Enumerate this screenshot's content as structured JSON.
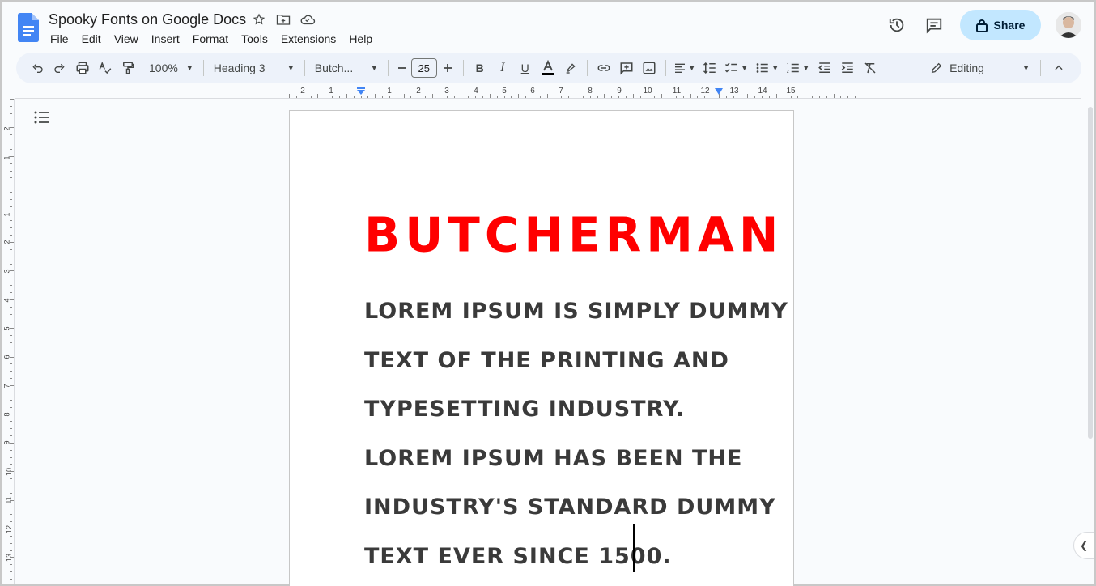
{
  "doc": {
    "title": "Spooky Fonts on Google Docs",
    "menu": [
      "File",
      "Edit",
      "View",
      "Insert",
      "Format",
      "Tools",
      "Extensions",
      "Help"
    ]
  },
  "header": {
    "share_label": "Share"
  },
  "toolbar": {
    "zoom": "100%",
    "style": "Heading 3",
    "font": "Butch...",
    "font_size": "25",
    "mode": "Editing"
  },
  "ruler": {
    "top_marks": [
      "2",
      "1",
      "1",
      "2",
      "3",
      "4",
      "5",
      "6",
      "7",
      "8",
      "9",
      "10",
      "11",
      "12",
      "13",
      "14",
      "15"
    ],
    "left_marks": [
      "2",
      "1",
      "1",
      "2",
      "3",
      "4",
      "5",
      "6",
      "7",
      "8",
      "9",
      "10",
      "11",
      "12",
      "13"
    ]
  },
  "document": {
    "heading": "BUTCHERMAN",
    "lines": [
      "LOREM IPSUM IS SIMPLY DUMMY",
      "TEXT OF THE PRINTING AND",
      "TYPESETTING INDUSTRY.",
      "LOREM IPSUM HAS BEEN THE",
      "INDUSTRY'S STANDARD DUMMY",
      "TEXT EVER SINCE 1500."
    ]
  },
  "colors": {
    "heading": "#ff0000",
    "share_bg": "#c2e7ff",
    "toolbar_bg": "#edf2fa",
    "doc_blue": "#4285f4"
  }
}
